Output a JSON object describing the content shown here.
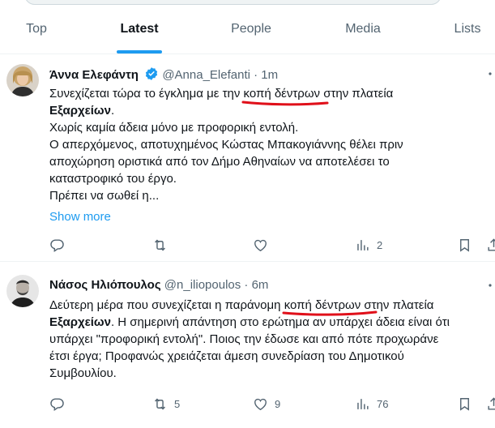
{
  "tabs": [
    {
      "label": "Top"
    },
    {
      "label": "Latest"
    },
    {
      "label": "People"
    },
    {
      "label": "Media"
    },
    {
      "label": "Lists"
    }
  ],
  "active_tab": "Latest",
  "colors": {
    "accent": "#1d9bf0",
    "text": "#0f1419",
    "muted": "#536471",
    "annotation": "#e0101a"
  },
  "tweets": [
    {
      "name": "Άννα Ελεφάντη",
      "verified": true,
      "handle": "@Anna_Elefanti",
      "dot": "·",
      "time": "1m",
      "line1_pre": "Συνεχίζεται τώρα το έγκλημα με την ",
      "line1_hl": "κοπή δέντρων",
      "line1_post": " στην πλατεία",
      "line2_bold": "Εξαρχείων",
      "line2_post": ".",
      "line3": "Χωρίς καμία άδεια μόνο με προφορική εντολή.",
      "line4": "Ο απερχόμενος, αποτυχημένος Κώστας Μπακογιάννης θέλει πριν",
      "line5": "αποχώρηση οριστικά από τον Δήμο Αθηναίων να αποτελέσει το",
      "line6": "καταστροφικό του έργο.",
      "line7": "Πρέπει να σωθεί η...",
      "show_more": "Show more",
      "replies": "",
      "reposts": "",
      "likes": "",
      "views": "2"
    },
    {
      "name": "Νάσος Ηλιόπουλος",
      "verified": false,
      "handle": "@n_iliopoulos",
      "dot": "·",
      "time": "6m",
      "line1_pre": "Δεύτερη μέρα που συνεχίζεται η παράνομη ",
      "line1_hl": "κοπή δέντρων",
      "line1_post": " στην πλατεία",
      "line2_bold": "Εξαρχείων",
      "line2_post": ". Η σημερινή απάντηση στο ερώτημα αν υπάρχει άδεια είναι ότι",
      "line3": "υπάρχει \"προφορική εντολή\". Ποιος την έδωσε και από πότε προχωράνε",
      "line4": "έτσι έργα; Προφανώς χρειάζεται άμεση συνεδρίαση του Δημοτικού",
      "line5": "Συμβουλίου.",
      "replies": "",
      "reposts": "5",
      "likes": "9",
      "views": "76"
    }
  ]
}
